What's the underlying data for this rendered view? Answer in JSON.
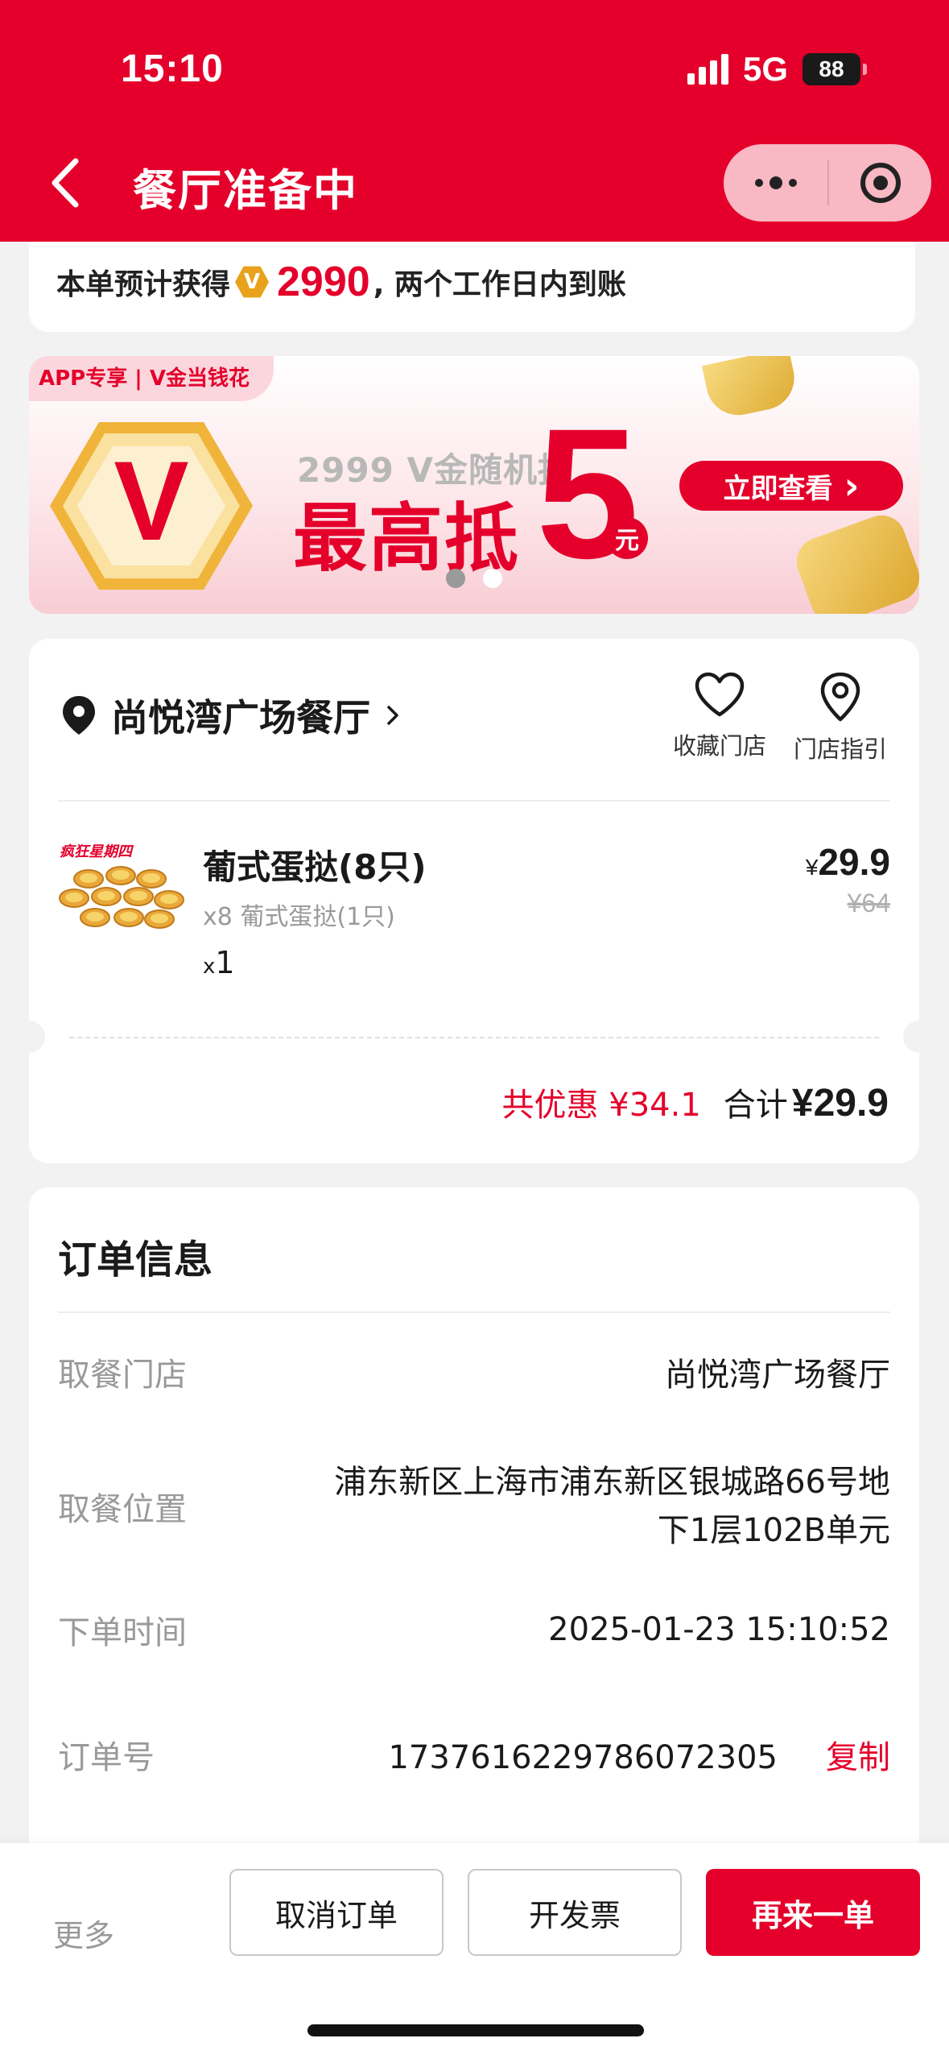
{
  "status_bar": {
    "time": "15:10",
    "network": "5G",
    "battery": "88"
  },
  "nav": {
    "title": "餐厅准备中"
  },
  "points": {
    "prefix": "本单预计获得",
    "coin_letter": "V",
    "amount": "2990",
    "suffix": ", 两个工作日内到账"
  },
  "banner": {
    "tag": "APP专享 | V金当钱花",
    "logo_letter": "V",
    "subtitle": "2999 V金随机抽",
    "headline": "最高抵",
    "big_number": "5",
    "unit": "元",
    "cta": "立即查看",
    "cta_arrow": "›",
    "slide_count": 2,
    "active_slide": 0
  },
  "store": {
    "name": "尚悦湾广场餐厅",
    "favorite_label": "收藏门店",
    "directions_label": "门店指引",
    "item": {
      "image_caption": "疯狂星期四",
      "name": "葡式蛋挞(8只)",
      "detail": "x8 葡式蛋挞(1只)",
      "qty_x": "x",
      "qty": "1",
      "currency": "¥",
      "price": "29.9",
      "original_price": "¥64"
    },
    "discount": "共优惠 ¥34.1",
    "total_label": "合计",
    "total_value": "¥29.9"
  },
  "order_info": {
    "title": "订单信息",
    "rows": [
      {
        "label": "取餐门店",
        "value": "尚悦湾广场餐厅"
      },
      {
        "label": "取餐位置",
        "value_line1": "浦东新区上海市浦东新区银城路66号地",
        "value_line2": "下1层102B单元"
      },
      {
        "label": "下单时间",
        "value": "2025-01-23 15:10:52"
      },
      {
        "label": "订单号",
        "value": "1737616229786072305",
        "action": "复制"
      }
    ]
  },
  "bottom_bar": {
    "more": "更多",
    "cancel": "取消订单",
    "invoice": "开发票",
    "reorder": "再来一单"
  },
  "colors": {
    "brand_red": "#e4002b",
    "background": "#f2f2f2",
    "muted_text": "#999999"
  }
}
